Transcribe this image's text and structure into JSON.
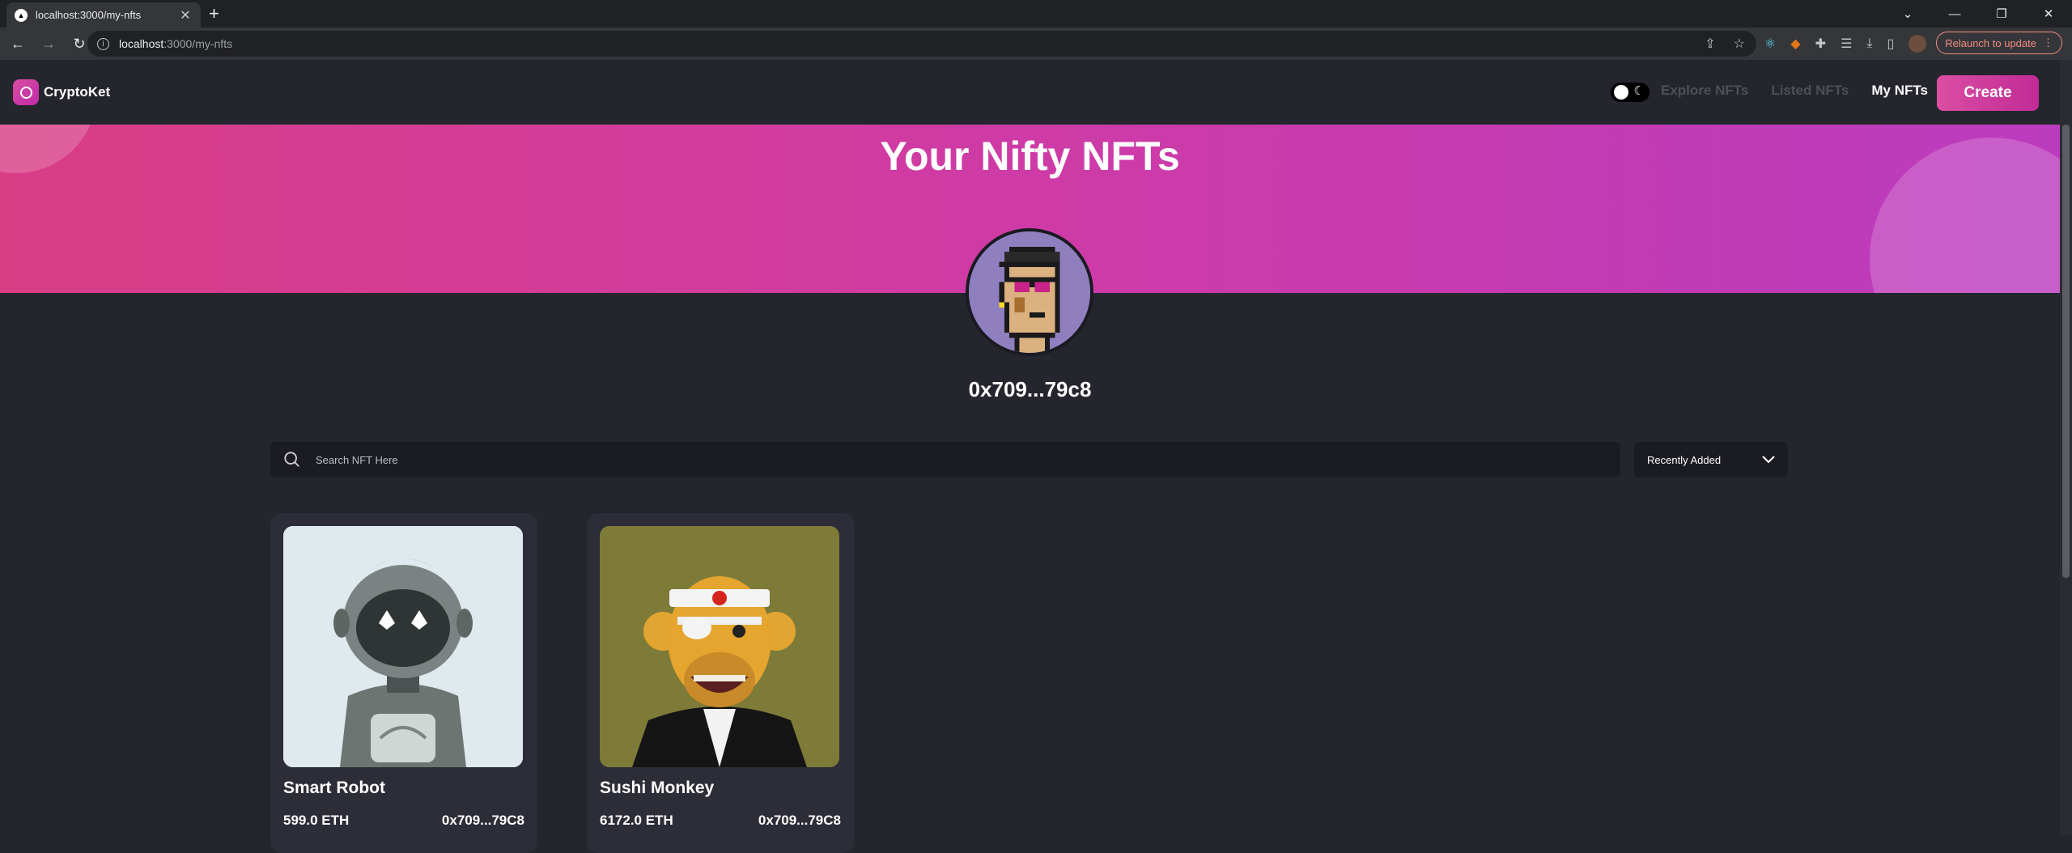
{
  "browser": {
    "tab_title": "localhost:3000/my-nfts",
    "url_host": "localhost",
    "url_path": ":3000/my-nfts",
    "relaunch_label": "Relaunch to update"
  },
  "app": {
    "logo_text": "CryptoKet",
    "nav": [
      {
        "label": "Explore NFTs",
        "active": false
      },
      {
        "label": "Listed NFTs",
        "active": false
      },
      {
        "label": "My NFTs",
        "active": true
      }
    ],
    "create_label": "Create",
    "accent_color": "#da4ea2"
  },
  "banner": {
    "title": "Your Nifty NFTs"
  },
  "profile": {
    "wallet": "0x709...79c8"
  },
  "search": {
    "placeholder": "Search NFT Here",
    "sort_selected": "Recently Added"
  },
  "nfts": [
    {
      "name": "Smart Robot",
      "price": "599.0 ETH",
      "owner": "0x709...79C8"
    },
    {
      "name": "Sushi Monkey",
      "price": "6172.0 ETH",
      "owner": "0x709...79C8"
    }
  ]
}
